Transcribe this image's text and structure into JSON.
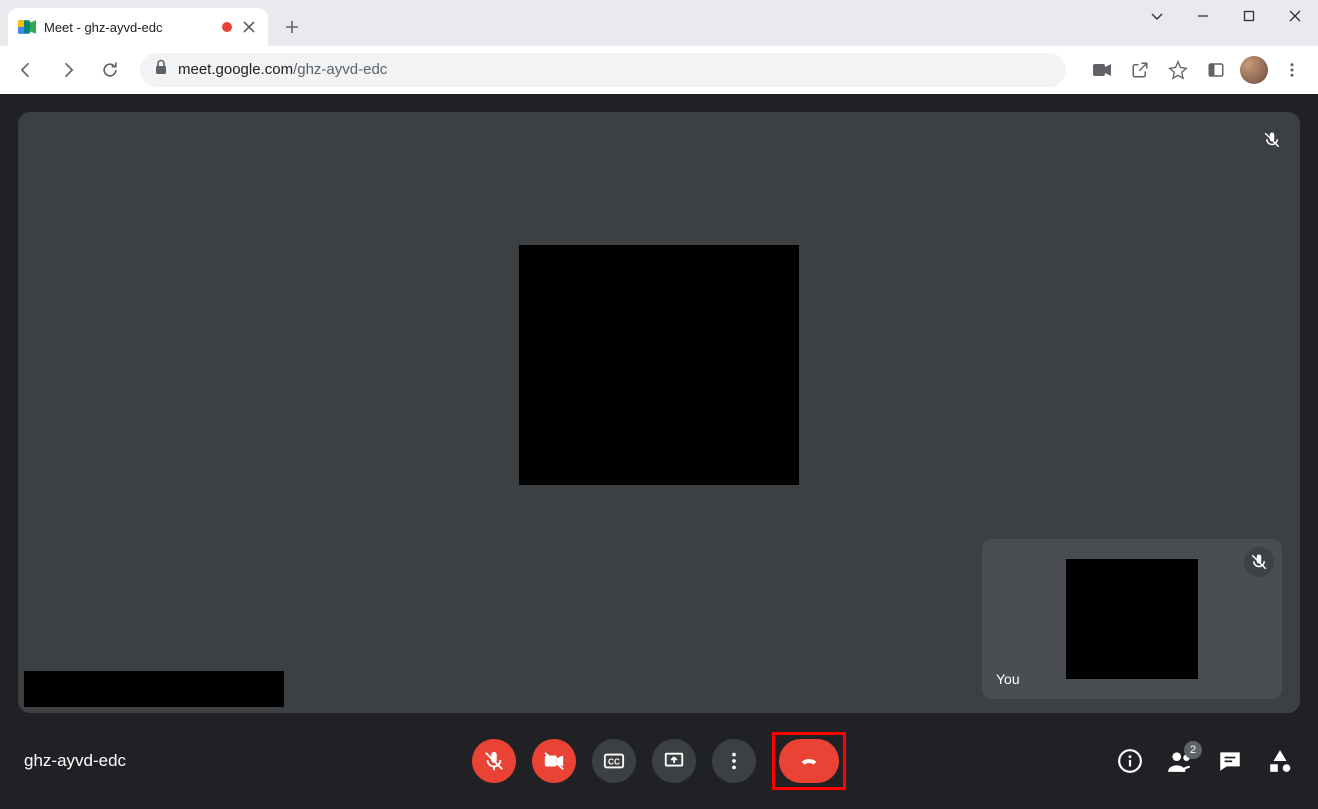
{
  "window": {
    "tab_title": "Meet - ghz-ayvd-edc",
    "url_host": "meet.google.com",
    "url_path": "/ghz-ayvd-edc"
  },
  "meet": {
    "self_label": "You",
    "meeting_code": "ghz-ayvd-edc",
    "participant_count": "2"
  }
}
